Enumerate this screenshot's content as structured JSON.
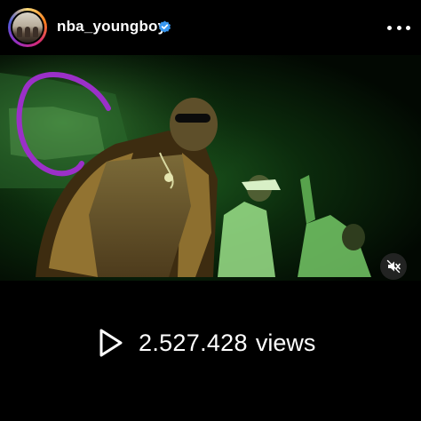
{
  "post": {
    "username": "nba_youngboy",
    "verified": true,
    "avatar_icon": "profile-avatar"
  },
  "video": {
    "muted": true,
    "mute_icon": "speaker-muted-icon",
    "annotation_color": "#9b30c8"
  },
  "stats": {
    "play_icon": "play-outline-icon",
    "views_count": "2.527.428",
    "views_label": "views"
  },
  "colors": {
    "background": "#000000",
    "verified_badge": "#3897f0",
    "video_tint": "#1d5b1f"
  }
}
